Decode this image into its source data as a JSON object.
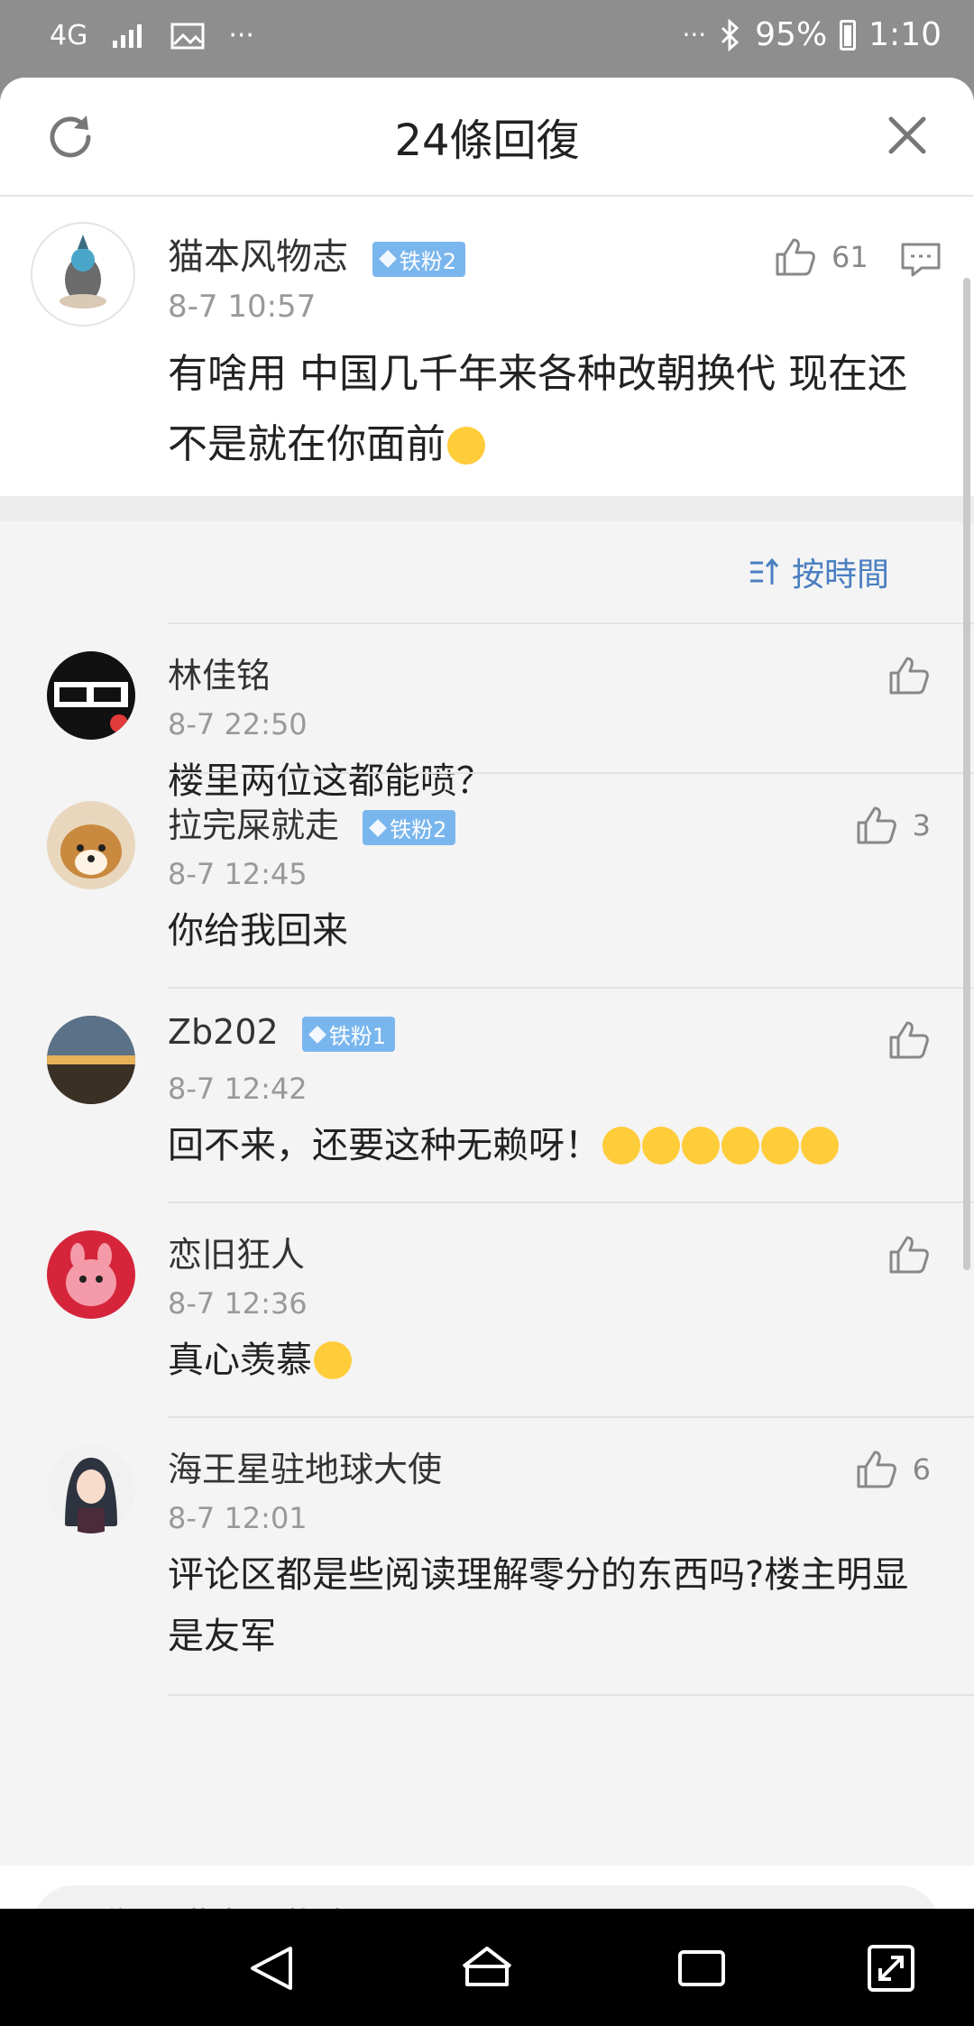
{
  "status_bar": {
    "network": "4G",
    "battery": "95%",
    "time": "1:10"
  },
  "header": {
    "title": "24條回復"
  },
  "main_comment": {
    "username": "猫本风物志",
    "badge": "铁粉2",
    "time": "8-7 10:57",
    "likes": "61",
    "text": "有啥用 中国几千年来各种改朝换代 现在还不是就在你面前"
  },
  "sort": {
    "label": "按時間"
  },
  "replies": [
    {
      "username": "林佳铭",
      "badge": "",
      "time": "8-7 22:50",
      "likes": "",
      "text": "楼里两位这都能喷？"
    },
    {
      "username": "拉完屎就走",
      "badge": "铁粉2",
      "time": "8-7 12:45",
      "likes": "3",
      "text": "你给我回来"
    },
    {
      "username": "Zb202",
      "badge": "铁粉1",
      "time": "8-7 12:42",
      "likes": "",
      "text": "回不来，还要这种无赖呀！"
    },
    {
      "username": "恋旧狂人",
      "badge": "",
      "time": "8-7 12:36",
      "likes": "",
      "text": "真心羡慕"
    },
    {
      "username": "海王星驻地球大使",
      "badge": "",
      "time": "8-7 12:01",
      "likes": "6",
      "text": "评论区都是些阅读理解零分的东西吗?楼主明显是友军"
    }
  ],
  "reply_input": {
    "placeholder": "回復@猫本风物志"
  },
  "colors": {
    "accent": "#4a7fc1",
    "badge": "#7ab6ee",
    "status_bar_bg": "#8e8e8e"
  },
  "icons": {
    "refresh": "refresh-icon",
    "close": "close-icon",
    "like": "thumbs-up-icon",
    "comment": "comment-icon",
    "sort": "sort-icon",
    "back": "back-icon",
    "home": "home-icon",
    "recents": "recents-icon",
    "expand": "expand-icon"
  }
}
